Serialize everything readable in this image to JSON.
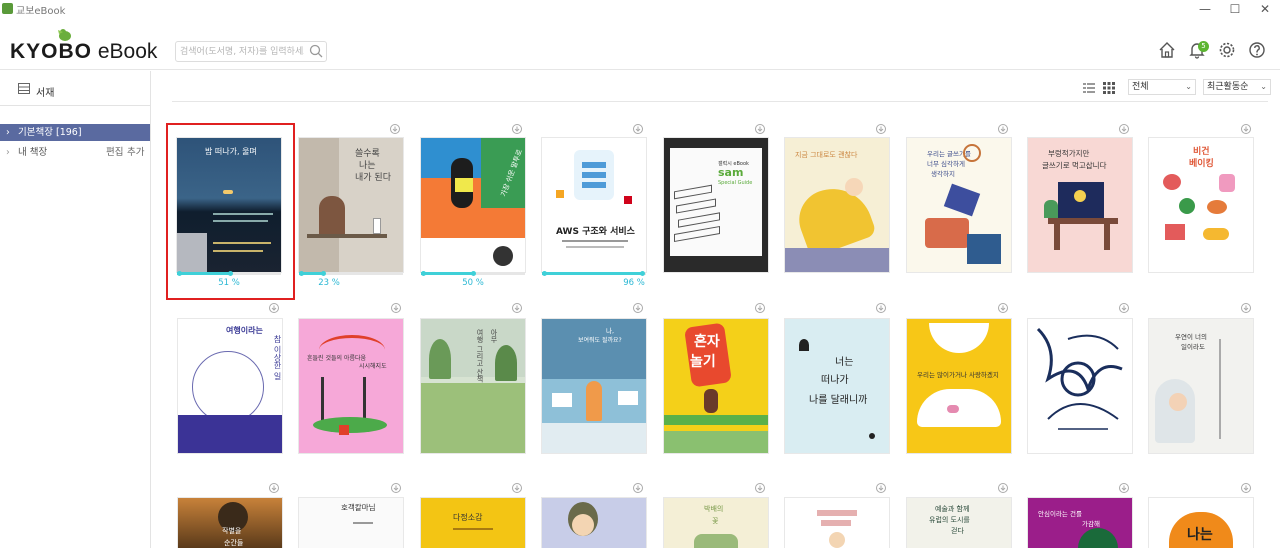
{
  "window": {
    "title": "교보eBook",
    "min": "—",
    "max": "☐",
    "close": "✕"
  },
  "header": {
    "logo_brand": "KYOBO",
    "logo_product": "eBook",
    "search_placeholder": "검색어(도서명, 저자)를 입력하세요.",
    "notification_count": "5"
  },
  "sidebar": {
    "title": "서재",
    "items": [
      {
        "label": "기본책장",
        "count": "[196]",
        "active": true
      },
      {
        "label": "내 책장",
        "edit": "편집",
        "add": "추가",
        "active": false
      }
    ]
  },
  "toolbar": {
    "filter_value": "전체",
    "sort_value": "최근활동순"
  },
  "books_row1": [
    {
      "t1": "밤 떠나가, 울며",
      "progress": "51 %",
      "progress_value": 0.51
    },
    {
      "t1": "쓸수록",
      "t2": "나는",
      "t3": "내가 된다",
      "progress": "23 %",
      "progress_value": 0.23
    },
    {
      "t1": "가장 쉬운 말투로",
      "progress": "50 %",
      "progress_value": 0.5
    },
    {
      "t1": "AWS 구조와 서비스",
      "progress": "96 %",
      "progress_value": 0.96
    },
    {
      "t1": "갤럭시 eBook",
      "t2": "sam",
      "t3": "Special Guide"
    },
    {
      "t1": "지금 그대로도 괜찮다"
    },
    {
      "t1": "우리는 글쓰기를",
      "t2": "너무 심각하게",
      "t3": "생각하지"
    },
    {
      "t1": "부렁적가지만",
      "t2": "글쓰기로 먹고삽니다"
    },
    {
      "t1": "비건",
      "t2": "베이킹"
    }
  ],
  "books_row2": [
    {
      "t1": "여행이라는",
      "t2": "참 이상한 일"
    },
    {
      "t1": "흔들린 것들의 아름다움",
      "t2": "시시해지도"
    },
    {
      "t1": "아무",
      "t2": "여행 그리고 산책"
    },
    {
      "t1": "나,",
      "t2": "보여줘도 될까요?"
    },
    {
      "t1": "혼자",
      "t2": "놀기"
    },
    {
      "t1": "너는",
      "t2": "떠나가",
      "t3": "나를 달래니까"
    },
    {
      "t1": "우리는 많이가거나 사랑하겠지"
    },
    {
      "t1": "ㅡ"
    },
    {
      "t1": "우연이 너의",
      "t2": "일이라도"
    }
  ],
  "books_row3": [
    {
      "t1": "작별을",
      "t2": "순간들"
    },
    {
      "t1": "호객칼마님"
    },
    {
      "t1": "다정소감"
    },
    {
      "t1": "ㅡ"
    },
    {
      "t1": "박배의",
      "t2": "꽃"
    },
    {
      "t1": "ㅡ"
    },
    {
      "t1": "예술과 함께",
      "t2": "유럽의 도시를",
      "t3": "걷다"
    },
    {
      "t1": "안심이라는 건를",
      "t2": "가감해"
    },
    {
      "t1": "나는"
    }
  ],
  "colors": {
    "accent": "#3fd0d8",
    "sidebar_active": "#5a6aa0",
    "badge": "#5cb531",
    "selection": "#e02020"
  }
}
